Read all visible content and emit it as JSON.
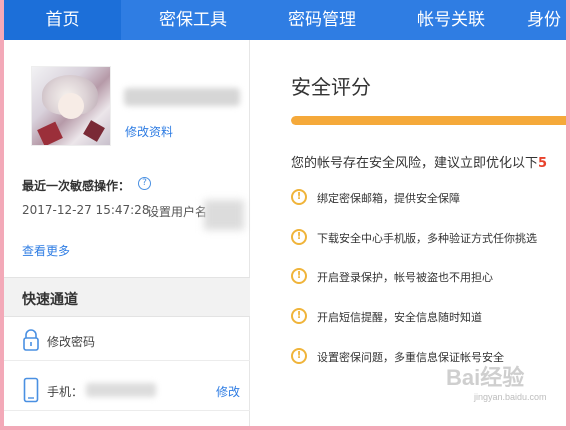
{
  "nav": {
    "tabs": [
      {
        "label": "首页",
        "active": true
      },
      {
        "label": "密保工具",
        "active": false
      },
      {
        "label": "密码管理",
        "active": false
      },
      {
        "label": "帐号关联",
        "active": false
      },
      {
        "label": "身份",
        "active": false
      }
    ],
    "colors": {
      "bar": "#2f7de3",
      "active": "#1c6fd9"
    }
  },
  "profile": {
    "edit_link": "修改资料"
  },
  "recent": {
    "title": "最近一次敏感操作：",
    "help_icon": "?",
    "time": "2017-12-27 15:47:28",
    "operation": "设置用户名",
    "view_more": "查看更多"
  },
  "quick": {
    "title": "快速通道",
    "change_password": "修改密码",
    "phone_label": "手机：",
    "phone_action": "修改"
  },
  "security": {
    "title": "安全评分",
    "score_fraction": 1.0,
    "bar_color": "#f5a93a",
    "risk_text": "您的帐号存在安全风险，建议立即优化以下",
    "risk_count": "5",
    "items": [
      {
        "label": "绑定密保邮箱，提供安全保障",
        "icon": "warning-icon"
      },
      {
        "label": "下载安全中心手机版，多种验证方式任你挑选",
        "icon": "warning-icon"
      },
      {
        "label": "开启登录保护，帐号被盗也不用担心",
        "icon": "warning-icon"
      },
      {
        "label": "开启短信提醒，安全信息随时知道",
        "icon": "warning-icon"
      },
      {
        "label": "设置密保问题，多重信息保证帐号安全",
        "icon": "warning-icon"
      }
    ]
  },
  "watermark": {
    "text": "Bai经验",
    "sub": "jingyan.baidu.com"
  }
}
